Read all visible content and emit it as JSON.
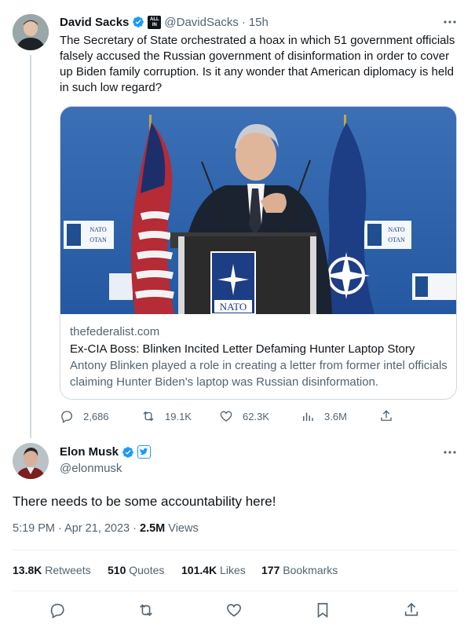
{
  "parent_tweet": {
    "author_name": "David Sacks",
    "badge_text": "ALL IN",
    "handle": "@DavidSacks",
    "separator": "·",
    "time": "15h",
    "text": "The Secretary of State orchestrated a hoax in which 51 government officials falsely accused the Russian government of disinformation in order to cover up Biden family corruption. Is it any wonder that American diplomacy is held in such low regard?",
    "card": {
      "podium_sign": "NATO",
      "banner_text_1": "NATO",
      "banner_text_2": "OTAN",
      "domain": "thefederalist.com",
      "title": "Ex-CIA Boss: Blinken Incited Letter Defaming Hunter Laptop Story",
      "description": "Antony Blinken played a role in creating a letter from former intel officials claiming Hunter Biden's laptop was Russian disinformation."
    },
    "actions": {
      "replies": "2,686",
      "retweets": "19.1K",
      "likes": "62.3K",
      "views": "3.6M"
    }
  },
  "main_tweet": {
    "author_name": "Elon Musk",
    "handle": "@elonmusk",
    "text": "There needs to be some accountability here!",
    "timestamp": "5:19 PM · Apr 21, 2023 · ",
    "views_count": "2.5M",
    "views_label": " Views",
    "stats": {
      "retweets_count": "13.8K",
      "retweets_label": " Retweets",
      "quotes_count": "510",
      "quotes_label": " Quotes",
      "likes_count": "101.4K",
      "likes_label": " Likes",
      "bookmarks_count": "177",
      "bookmarks_label": " Bookmarks"
    }
  },
  "colors": {
    "verified": "#1d9bf0",
    "muted": "#536471",
    "border": "#cfd9de"
  }
}
